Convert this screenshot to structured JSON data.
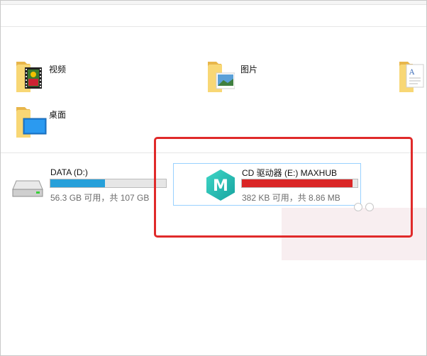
{
  "folders": [
    {
      "id": "videos",
      "label": "视频",
      "icon": "video-folder-icon"
    },
    {
      "id": "pictures",
      "label": "图片",
      "icon": "picture-folder-icon"
    },
    {
      "id": "documents",
      "label": "",
      "icon": "document-folder-icon"
    },
    {
      "id": "desktop",
      "label": "桌面",
      "icon": "desktop-folder-icon"
    }
  ],
  "drives": [
    {
      "id": "data-d",
      "name": "DATA (D:)",
      "info": "56.3 GB 可用，共 107 GB",
      "used_fraction": 0.47,
      "bar_color": "#26a0da",
      "icon": "hard-drive-icon"
    },
    {
      "id": "cd-e",
      "name": "CD 驱动器 (E:) MAXHUB",
      "info": "382 KB 可用，共 8.86 MB",
      "used_fraction": 0.96,
      "bar_color": "#da2626",
      "icon": "maxhub-logo-icon",
      "logo_letter": "M"
    }
  ],
  "colors": {
    "highlight_outline": "#e02a2a",
    "selection_border": "#99d1ff",
    "folder_yellow": "#f8d775"
  }
}
